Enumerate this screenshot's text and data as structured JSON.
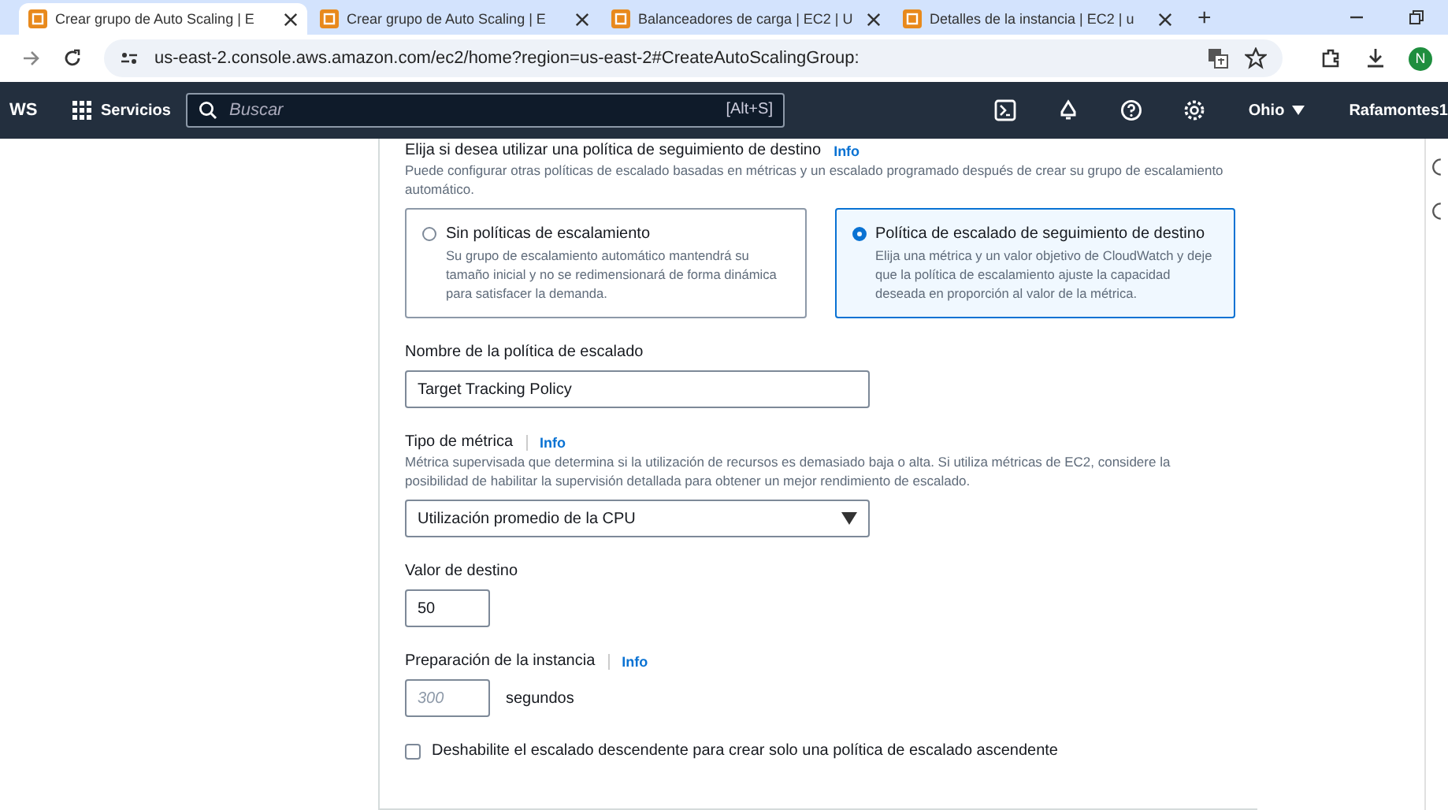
{
  "browser": {
    "tabs": [
      {
        "title": "Crear grupo de Auto Scaling | E",
        "selected": true
      },
      {
        "title": "Crear grupo de Auto Scaling | E",
        "selected": false
      },
      {
        "title": "Balanceadores de carga | EC2 | U",
        "selected": false
      },
      {
        "title": "Detalles de la instancia | EC2 | u",
        "selected": false
      }
    ],
    "new_tab": "+",
    "url": "us-east-2.console.aws.amazon.com/ec2/home?region=us-east-2#CreateAutoScalingGroup:",
    "profile": "N"
  },
  "aws_nav": {
    "logo": "WS",
    "services": "Servicios",
    "search_placeholder": "Buscar",
    "shortcut": "[Alt+S]",
    "region": "Ohio",
    "account": "Rafamontes1"
  },
  "form": {
    "heading": "Elija si desea utilizar una política de seguimiento de destino",
    "heading_info": "Info",
    "description": "Puede configurar otras políticas de escalado basadas en métricas y un escalado programado después de crear su grupo de escalamiento automático.",
    "options": [
      {
        "title": "Sin políticas de escalamiento",
        "description": "Su grupo de escalamiento automático mantendrá su tamaño inicial y no se redimensionará de forma dinámica para satisfacer la demanda.",
        "selected": false
      },
      {
        "title": "Política de escalado de seguimiento de destino",
        "description": "Elija una métrica y un valor objetivo de CloudWatch y deje que la política de escalamiento ajuste la capacidad deseada en proporción al valor de la métrica.",
        "selected": true
      }
    ],
    "policy_name": {
      "label": "Nombre de la política de escalado",
      "value": "Target Tracking Policy"
    },
    "metric": {
      "label": "Tipo de métrica",
      "info": "Info",
      "description": "Métrica supervisada que determina si la utilización de recursos es demasiado baja o alta. Si utiliza métricas de EC2, considere la posibilidad de habilitar la supervisión detallada para obtener un mejor rendimiento de escalado.",
      "value": "Utilización promedio de la CPU"
    },
    "target": {
      "label": "Valor de destino",
      "value": "50"
    },
    "warmup": {
      "label": "Preparación de la instancia",
      "info": "Info",
      "placeholder": "300",
      "unit": "segundos"
    },
    "disable_scale_in": {
      "label": "Deshabilite el escalado descendente para crear solo una política de escalado ascendente",
      "checked": false
    }
  }
}
